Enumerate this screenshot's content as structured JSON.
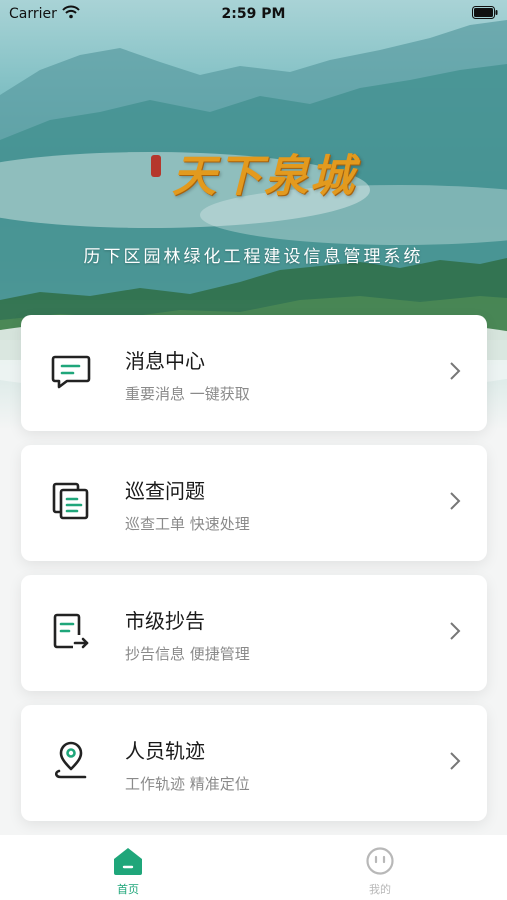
{
  "status_bar": {
    "carrier": "Carrier",
    "time": "2:59 PM"
  },
  "header": {
    "brand_title": "天下泉城",
    "system_title": "历下区园林绿化工程建设信息管理系统"
  },
  "menu": [
    {
      "title": "消息中心",
      "subtitle": "重要消息 一键获取",
      "icon": "message-icon"
    },
    {
      "title": "巡查问题",
      "subtitle": "巡查工单 快速处理",
      "icon": "document-stack-icon"
    },
    {
      "title": "市级抄告",
      "subtitle": "抄告信息 便捷管理",
      "icon": "report-forward-icon"
    },
    {
      "title": "人员轨迹",
      "subtitle": "工作轨迹 精准定位",
      "icon": "location-pin-icon"
    }
  ],
  "tabbar": {
    "home_label": "首页",
    "mine_label": "我的"
  },
  "colors": {
    "accent": "#1fa67a",
    "brand_gold": "#e39a1e"
  }
}
